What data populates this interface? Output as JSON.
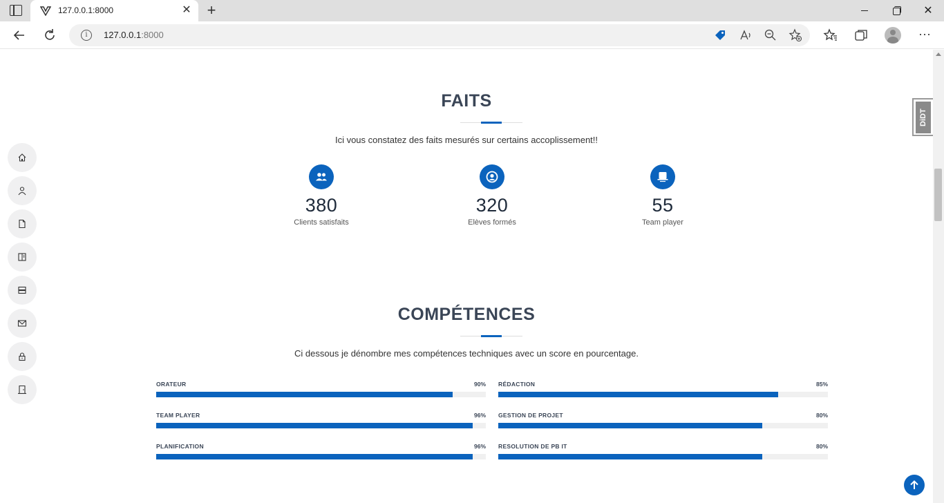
{
  "browser": {
    "tab_title": "127.0.0.1:8000",
    "address_host": "127.0.0.1",
    "address_port": ":8000"
  },
  "side_nav": [
    {
      "icon": "home-icon"
    },
    {
      "icon": "user-icon"
    },
    {
      "icon": "file-icon"
    },
    {
      "icon": "book-icon"
    },
    {
      "icon": "server-icon"
    },
    {
      "icon": "envelope-icon"
    },
    {
      "icon": "lock-icon"
    },
    {
      "icon": "door-icon"
    }
  ],
  "facts": {
    "title": "FAITS",
    "subtitle": "Ici vous constatez des faits mesurés sur certains accoplissement!!",
    "items": [
      {
        "icon": "people-icon",
        "number": "380",
        "label": "Clients satisfaits"
      },
      {
        "icon": "user-circle-icon",
        "number": "320",
        "label": "Elèves formés"
      },
      {
        "icon": "chalkboard-icon",
        "number": "55",
        "label": "Team player"
      }
    ]
  },
  "skills": {
    "title": "COMPÉTENCES",
    "subtitle": "Ci dessous je dénombre mes compétences techniques avec un score en pourcentage.",
    "items": [
      {
        "name": "ORATEUR",
        "value": "90%",
        "percent": 90
      },
      {
        "name": "RÉDACTION",
        "value": "85%",
        "percent": 85
      },
      {
        "name": "TEAM PLAYER",
        "value": "96%",
        "percent": 96
      },
      {
        "name": "GESTION DE PROJET",
        "value": "80%",
        "percent": 80
      },
      {
        "name": "PLANIFICATION",
        "value": "96%",
        "percent": 96
      },
      {
        "name": "RESOLUTION DE PB IT",
        "value": "80%",
        "percent": 80
      }
    ]
  },
  "badge": {
    "text": "DiDT"
  },
  "colors": {
    "accent": "#0b63bd",
    "heading": "#3a4556"
  }
}
